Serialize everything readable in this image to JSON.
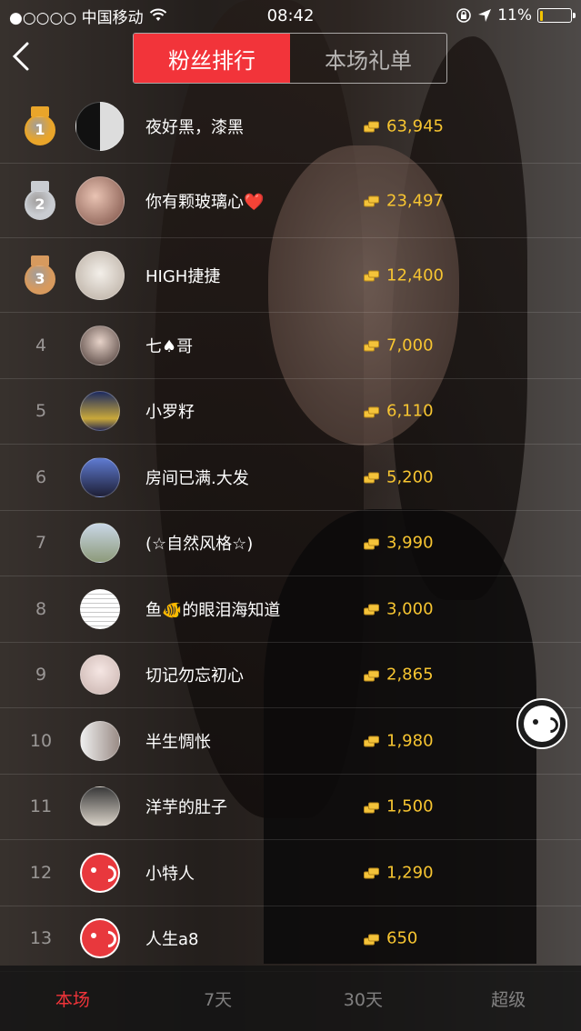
{
  "status_bar": {
    "carrier": "●○○○○ 中国移动",
    "time": "08:42",
    "battery": "11%",
    "battery_level": 0.11
  },
  "header": {
    "tabs": [
      {
        "label": "粉丝排行",
        "active": true
      },
      {
        "label": "本场礼单",
        "active": false
      }
    ]
  },
  "ranking": [
    {
      "rank": "1",
      "name": "夜好黑，漆黑",
      "amount": "63,945",
      "medal": "gold"
    },
    {
      "rank": "2",
      "name": "你有颗玻璃心❤️",
      "amount": "23,497",
      "medal": "silver"
    },
    {
      "rank": "3",
      "name": "HIGH捷捷",
      "amount": "12,400",
      "medal": "bronze"
    },
    {
      "rank": "4",
      "name": "七♠哥",
      "amount": "7,000"
    },
    {
      "rank": "5",
      "name": "小罗籽",
      "amount": "6,110"
    },
    {
      "rank": "6",
      "name": "房间已满.大发",
      "amount": "5,200"
    },
    {
      "rank": "7",
      "name": "(☆自然风格☆)",
      "amount": "3,990"
    },
    {
      "rank": "8",
      "name": "鱼🐠的眼泪海知道",
      "amount": "3,000"
    },
    {
      "rank": "9",
      "name": "切记勿忘初心",
      "amount": "2,865"
    },
    {
      "rank": "10",
      "name": "半生惆怅",
      "amount": "1,980"
    },
    {
      "rank": "11",
      "name": "洋芋的肚子",
      "amount": "1,500"
    },
    {
      "rank": "12",
      "name": "小特人",
      "amount": "1,290"
    },
    {
      "rank": "13",
      "name": "人生a8",
      "amount": "650"
    }
  ],
  "bottom_tabs": [
    {
      "label": "本场",
      "active": true
    },
    {
      "label": "7天",
      "active": false
    },
    {
      "label": "30天",
      "active": false
    },
    {
      "label": "超级",
      "active": false
    }
  ],
  "colors": {
    "accent": "#f2343a",
    "coin": "#f7c531",
    "gold": "#e9a52a",
    "silver": "#c9ccd1",
    "bronze": "#d79a5e"
  }
}
